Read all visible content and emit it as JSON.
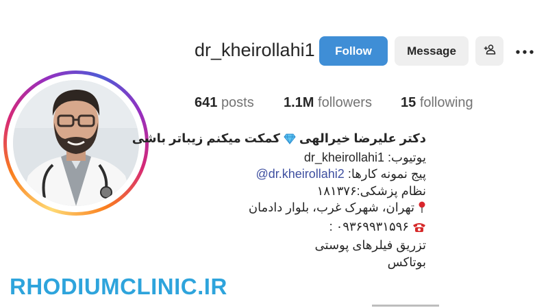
{
  "profile": {
    "username": "dr_kheirollahi1",
    "follow_label": "Follow",
    "message_label": "Message",
    "suggest_icon": "add-user-icon",
    "more_icon": "more-icon"
  },
  "stats": {
    "posts_count": "641",
    "posts_label": "posts",
    "followers_count": "1.1M",
    "followers_label": "followers",
    "following_count": "15",
    "following_label": "following"
  },
  "bio": {
    "name": "دکتر علیرضا خیرالهی",
    "tagline": "کمکت میکنم زیباتر باشی",
    "youtube_label": "یوتیوب:",
    "youtube_value": "dr_kheirollahi1",
    "page_label": "پیج نمونه کارها:",
    "page_mention": "@dr.kheirollahi2",
    "medical_code": "نظام پزشکی:۱۸۱۳۷۶",
    "address": "تهران، شهرک غرب، بلوار دادمان",
    "phone": "۰۹۳۶۹۹۳۱۵۹۶ :",
    "service_1": "تزریق فیلرهای پوستی",
    "service_2": "بوتاکس"
  },
  "watermark": "RHODIUMCLINIC.IR",
  "colors": {
    "follow_button": "#3f8ed6",
    "secondary_button": "#efefef",
    "mention": "#3e4fa0",
    "watermark": "#2ea4dc"
  }
}
